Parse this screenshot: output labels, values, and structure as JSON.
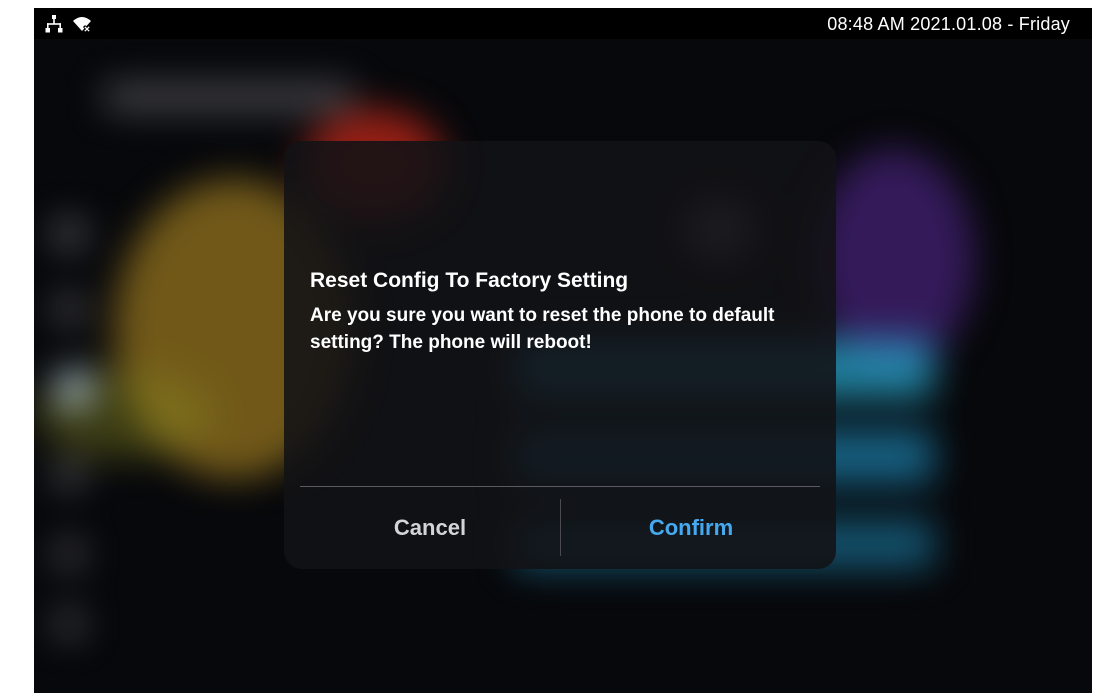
{
  "status_bar": {
    "clock": "08:48 AM  2021.01.08 - Friday",
    "icons": [
      "network-icon",
      "wifi-off-icon"
    ]
  },
  "dialog": {
    "title": "Reset Config To Factory Setting",
    "message": "Are you sure you want to reset the phone to default setting? The phone will reboot!",
    "cancel_label": "Cancel",
    "confirm_label": "Confirm"
  },
  "colors": {
    "confirm_accent": "#46a9f0",
    "cancel_text": "#d4d4d8",
    "dialog_background": "#121216",
    "status_bar_background": "#000000"
  }
}
